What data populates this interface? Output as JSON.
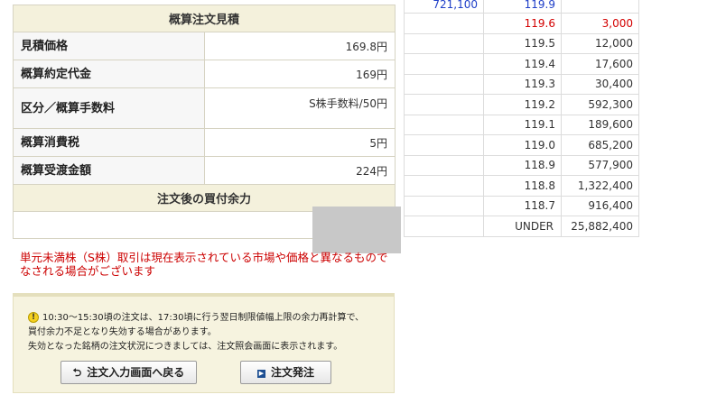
{
  "estimate": {
    "header": "概算注文見積",
    "rows": [
      {
        "label": "見積価格",
        "value": "169.8円"
      },
      {
        "label": "概算約定代金",
        "value": "169円"
      },
      {
        "label": "区分／概算手数料",
        "value": "S株手数料/50円"
      },
      {
        "label": "概算消費税",
        "value": "5円"
      },
      {
        "label": "概算受渡金額",
        "value": "224円"
      }
    ],
    "buying_power_header": "注文後の買付余力",
    "buying_power_value": ""
  },
  "warning_text": "単元未満株（S株）取引は現在表示されている市場や価格と異なるものでなされる場合がございます",
  "notice": {
    "line1": "10:30～15:30頃の注文は、17:30頃に行う翌日制限値幅上限の余力再計算で、",
    "line2": "買付余力不足となり失効する場合があります。",
    "line3": "失効となった銘柄の注文状況につきましては、注文照会画面に表示されます。",
    "back_button": "注文入力画面へ戻る",
    "order_button": "注文発注",
    "icon": "warning-info-icon"
  },
  "board": {
    "top": {
      "sell_qty": "721,100",
      "price": "119.9",
      "buy_qty": ""
    },
    "rows": [
      {
        "price": "119.6",
        "qty": "3,000",
        "highlight": true
      },
      {
        "price": "119.5",
        "qty": "12,000"
      },
      {
        "price": "119.4",
        "qty": "17,600"
      },
      {
        "price": "119.3",
        "qty": "30,400"
      },
      {
        "price": "119.2",
        "qty": "592,300"
      },
      {
        "price": "119.1",
        "qty": "189,600"
      },
      {
        "price": "119.0",
        "qty": "685,200"
      },
      {
        "price": "118.9",
        "qty": "577,900"
      },
      {
        "price": "118.8",
        "qty": "1,322,400"
      },
      {
        "price": "118.7",
        "qty": "916,400"
      },
      {
        "price": "UNDER",
        "qty": "25,882,400"
      }
    ]
  },
  "colors": {
    "sell": "#1f3fc8",
    "red": "#d30000",
    "panel": "#f4f1dc"
  }
}
